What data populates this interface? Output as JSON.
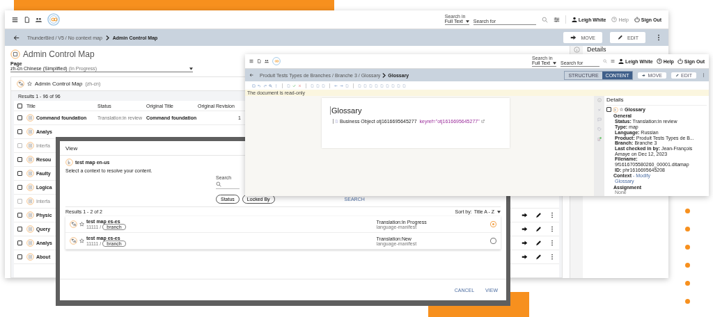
{
  "main_window": {
    "toolbar": {
      "search_in_label": "Search in",
      "search_in_value": "Full Text",
      "search_placeholder": "Search for",
      "user": "Leigh White",
      "help": "Help",
      "sign_out": "Sign Out"
    },
    "breadcrumb": {
      "path": "ThunderBird / V5 / No context map",
      "current": "Admin Control Map"
    },
    "actions": [
      "MOVE",
      "EDIT"
    ],
    "page_title": "Admin Control Map",
    "page_field": {
      "label": "Page",
      "value": "zh-cn Chinese (Simplified)",
      "status": "(In Progress)"
    },
    "map_header": {
      "title": "Admin Control Map",
      "locale": "(zh-cn)"
    },
    "results": "Results 1 - 96 of 96",
    "select_all_checked": false,
    "columns": [
      "Title",
      "Status",
      "Original Title",
      "Original Revision"
    ],
    "rows": [
      {
        "title": "Command foundation",
        "status": "Translation:in review",
        "original_title": "Command foundation",
        "revision": "1",
        "checked": false,
        "disabled": false
      },
      {
        "title": "Analys",
        "checked": false,
        "disabled": false
      },
      {
        "title": "Interfa",
        "checked": false,
        "disabled": true
      },
      {
        "title": "Resou",
        "checked": false,
        "disabled": false
      },
      {
        "title": "Faulty",
        "checked": false,
        "disabled": false
      },
      {
        "title": "Logica",
        "checked": false,
        "disabled": false
      },
      {
        "title": "Interfa",
        "checked": false,
        "disabled": true
      },
      {
        "title": "Physic",
        "checked": false,
        "disabled": false
      },
      {
        "title": "Query",
        "checked": false,
        "disabled": false
      },
      {
        "title": "Analys",
        "checked": false,
        "disabled": false
      },
      {
        "title": "About",
        "checked": false,
        "disabled": false
      }
    ],
    "details_title": "Details"
  },
  "editor_window": {
    "toolbar": {
      "search_in_label": "Search in",
      "search_in_value": "Full Text",
      "search_placeholder": "Search for",
      "user": "Leigh White",
      "help": "Help",
      "sign_out": "Sign Out"
    },
    "breadcrumb": {
      "path": "Produit Tests Types de Branches / Branche 3 / Glossary",
      "current": "Glossary"
    },
    "view_toggle": [
      {
        "label": "STRUCTURE",
        "selected": false
      },
      {
        "label": "CONTENT",
        "selected": true
      }
    ],
    "actions": [
      "MOVE",
      "EDIT"
    ],
    "notice": "The document is read-only",
    "document": {
      "title": "Glossary",
      "line": "Business Object otj1616695645277",
      "keyref": "keyref=\"otj1616695645277\""
    },
    "details": {
      "title": "Details",
      "item_checked": false,
      "item": "Glossary",
      "section": "General",
      "fields": [
        {
          "label": "Status:",
          "value": "Translation:in review"
        },
        {
          "label": "Type:",
          "value": "map"
        },
        {
          "label": "Language:",
          "value": "Russian"
        },
        {
          "label": "Product:",
          "value": "Produit Tests Types de B..."
        },
        {
          "label": "Branch:",
          "value": "Branche 3"
        },
        {
          "label": "Last checked in by:",
          "value": "Jean-François Amaye on Dec 12, 2023"
        },
        {
          "label": "Filename:",
          "value": "9f1616705580260_00001.ditamap"
        },
        {
          "label": "ID:",
          "value": "phr1616695645208"
        }
      ],
      "context_label": "Context",
      "context_link": "- Modify",
      "context_value": "Glossary",
      "assignment_label": "Assignment",
      "assignment_value": "None"
    }
  },
  "view_dialog": {
    "title": "View",
    "map": "test map en-us",
    "instruction": "Select a context to resolve your content.",
    "search_label": "Search",
    "filters": [
      "Status",
      "Locked By"
    ],
    "search_button": "SEARCH",
    "results": "Results 1 - 2 of 2",
    "sort_label": "Sort by:",
    "sort_value": "Title A - Z",
    "items": [
      {
        "title": "test map es-es",
        "path": "11111 /",
        "tag": "branch",
        "status": "Translation:In Progress",
        "type": "language-manifest",
        "selected": true
      },
      {
        "title": "test map es-es",
        "path": "11111 /",
        "tag": "branch",
        "status": "Translation:New",
        "type": "language-manifest",
        "selected": false
      }
    ],
    "buttons": [
      "CANCEL",
      "VIEW"
    ]
  }
}
